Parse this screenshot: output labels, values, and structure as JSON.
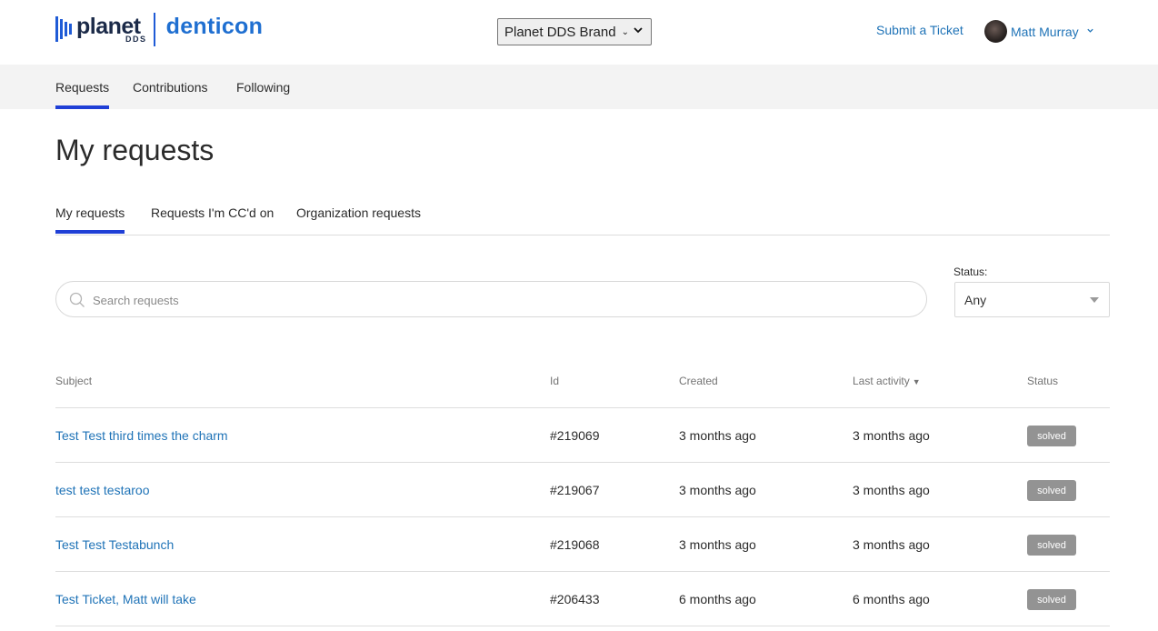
{
  "header": {
    "logo": {
      "name": "planet",
      "sub": "DDS",
      "product": "denticon"
    },
    "brand_select": {
      "value": "Planet DDS Brand"
    },
    "submit_ticket": "Submit a Ticket",
    "user": {
      "name": "Matt Murray"
    }
  },
  "nav": {
    "tabs": [
      {
        "label": "Requests",
        "active": true
      },
      {
        "label": "Contributions",
        "active": false
      },
      {
        "label": "Following",
        "active": false
      }
    ]
  },
  "main": {
    "title": "My requests",
    "subtabs": [
      {
        "label": "My requests",
        "active": true
      },
      {
        "label": "Requests I'm CC'd on",
        "active": false
      },
      {
        "label": "Organization requests",
        "active": false
      }
    ],
    "search": {
      "placeholder": "Search requests",
      "value": ""
    },
    "status_filter": {
      "label": "Status:",
      "value": "Any"
    }
  },
  "table": {
    "columns": {
      "subject": "Subject",
      "id": "Id",
      "created": "Created",
      "last_activity": "Last activity",
      "status": "Status"
    },
    "sort_indicator": "▼",
    "rows": [
      {
        "subject": "Test Test third times the charm",
        "id": "#219069",
        "created": "3 months ago",
        "last_activity": "3 months ago",
        "status": "solved"
      },
      {
        "subject": "test test testaroo",
        "id": "#219067",
        "created": "3 months ago",
        "last_activity": "3 months ago",
        "status": "solved"
      },
      {
        "subject": "Test Test Testabunch",
        "id": "#219068",
        "created": "3 months ago",
        "last_activity": "3 months ago",
        "status": "solved"
      },
      {
        "subject": "Test Ticket, Matt will take",
        "id": "#206433",
        "created": "6 months ago",
        "last_activity": "6 months ago",
        "status": "solved"
      }
    ]
  },
  "colors": {
    "link": "#1f73b7",
    "accent_underline": "#1f3fd6",
    "brand_blue": "#1f5bd6",
    "badge_bg": "#939393",
    "nav_bg": "#f3f3f3"
  }
}
